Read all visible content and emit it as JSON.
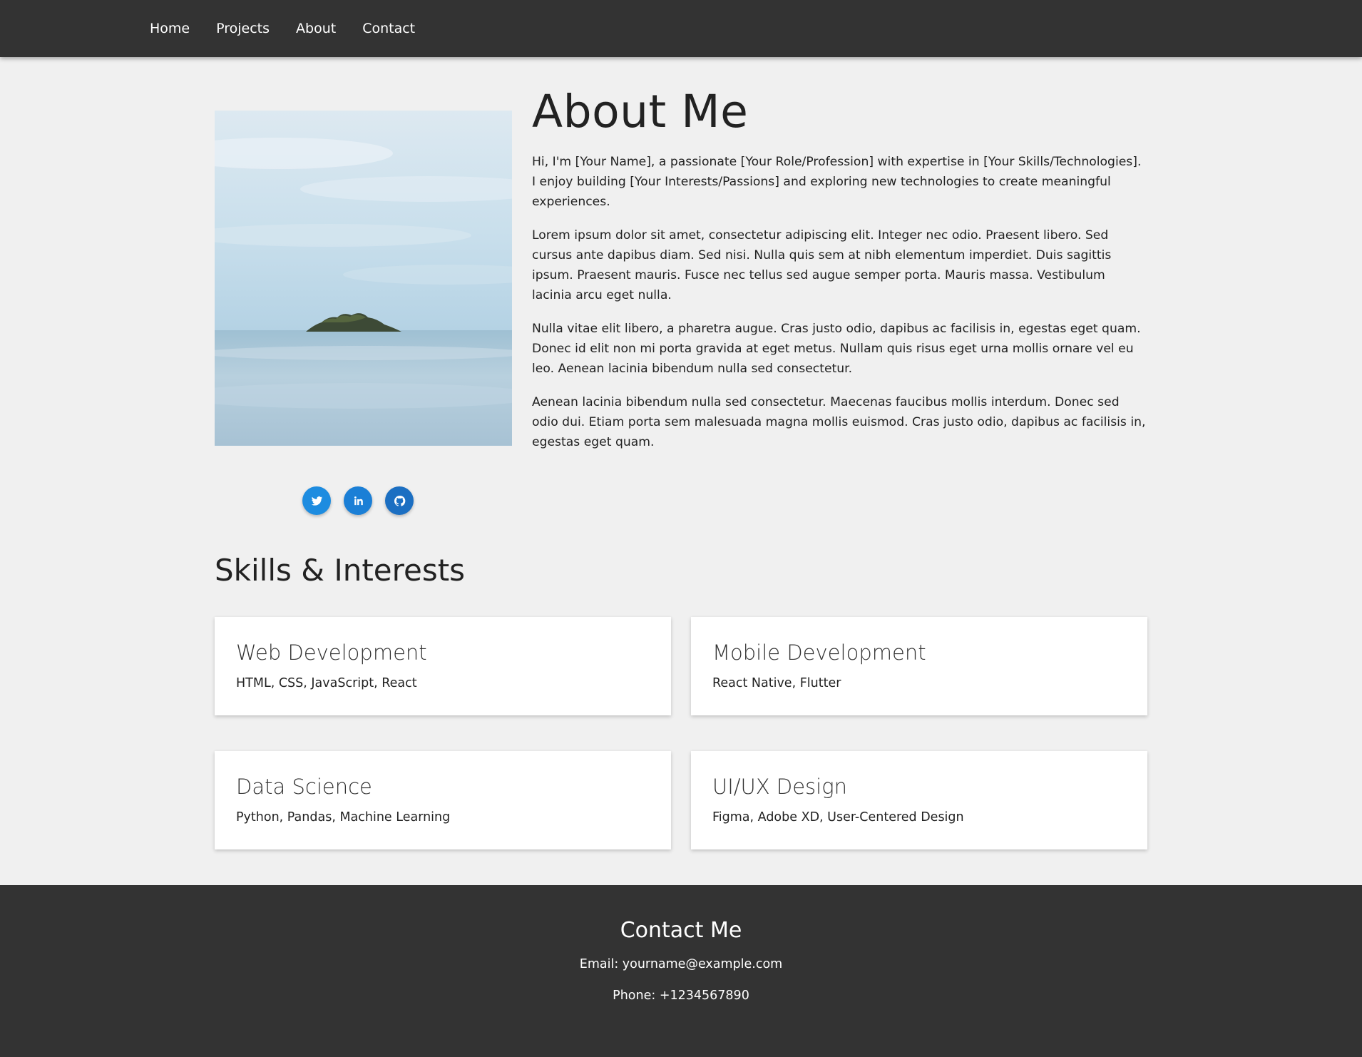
{
  "nav": {
    "items": [
      {
        "label": "Home"
      },
      {
        "label": "Projects"
      },
      {
        "label": "About"
      },
      {
        "label": "Contact"
      }
    ]
  },
  "about": {
    "title": "About Me",
    "paragraphs": [
      "Hi, I'm [Your Name], a passionate [Your Role/Profession] with expertise in [Your Skills/Technologies]. I enjoy building [Your Interests/Passions] and exploring new technologies to create meaningful experiences.",
      "Lorem ipsum dolor sit amet, consectetur adipiscing elit. Integer nec odio. Praesent libero. Sed cursus ante dapibus diam. Sed nisi. Nulla quis sem at nibh elementum imperdiet. Duis sagittis ipsum. Praesent mauris. Fusce nec tellus sed augue semper porta. Mauris massa. Vestibulum lacinia arcu eget nulla.",
      "Nulla vitae elit libero, a pharetra augue. Cras justo odio, dapibus ac facilisis in, egestas eget quam. Donec id elit non mi porta gravida at eget metus. Nullam quis risus eget urna mollis ornare vel eu leo. Aenean lacinia bibendum nulla sed consectetur.",
      "Aenean lacinia bibendum nulla sed consectetur. Maecenas faucibus mollis interdum. Donec sed odio dui. Etiam porta sem malesuada magna mollis euismod. Cras justo odio, dapibus ac facilisis in, egestas eget quam."
    ]
  },
  "socials": [
    {
      "icon": "twitter-icon",
      "color": "#1d8ce0"
    },
    {
      "icon": "linkedin-icon",
      "color": "#1b7fd6"
    },
    {
      "icon": "github-icon",
      "color": "#1c6fc2"
    }
  ],
  "skills": {
    "title": "Skills & Interests",
    "cards": [
      {
        "title": "Web Development",
        "text": "HTML, CSS, JavaScript, React"
      },
      {
        "title": "Mobile Development",
        "text": "React Native, Flutter"
      },
      {
        "title": "Data Science",
        "text": "Python, Pandas, Machine Learning"
      },
      {
        "title": "UI/UX Design",
        "text": "Figma, Adobe XD, User-Centered Design"
      }
    ]
  },
  "footer": {
    "title": "Contact Me",
    "email": "Email: yourname@example.com",
    "phone": "Phone: +1234567890"
  },
  "colors": {
    "nav_bg": "#333333",
    "page_bg": "#f0f0f0",
    "footer_bg": "#333333"
  }
}
